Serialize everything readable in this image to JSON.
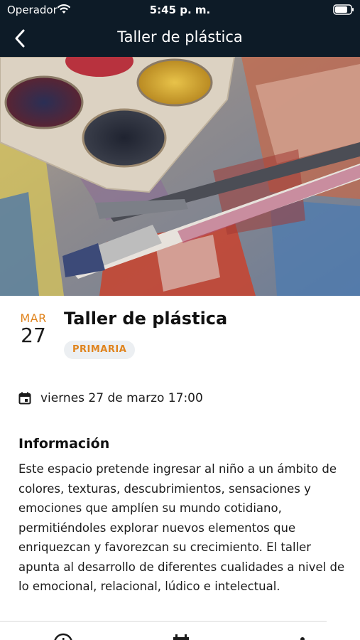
{
  "status_bar": {
    "carrier": "Operador",
    "time": "5:45 p. m."
  },
  "nav": {
    "back_icon": "chevron-left-icon",
    "title": "Taller de plástica"
  },
  "hero_image": {
    "description_icon": "paint-palette-image"
  },
  "event": {
    "month": "MAR",
    "day": "27",
    "title": "Taller de plástica",
    "tag": "PRIMARIA",
    "datetime": "viernes 27 de marzo 17:00"
  },
  "info": {
    "heading": "Información",
    "body": "Este espacio pretende ingresar al niño a un ámbito de colores, texturas, descubrimientos, sensaciones y emociones que amplíen su mundo cotidiano, permitiéndoles explorar nuevos elementos que enriquezcan y favorezcan su crecimiento. El taller apunta al desarrollo de diferentes cualidades a nivel de lo emocional, relacional, lúdico e intelectual."
  },
  "tab_bar": {
    "icons": [
      "clock-icon",
      "calendar-icon",
      "info-icon"
    ]
  },
  "colors": {
    "nav_background": "#0d1b27",
    "accent": "#e0841e",
    "badge_background": "#eceff2"
  }
}
